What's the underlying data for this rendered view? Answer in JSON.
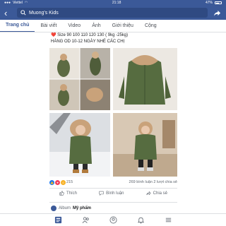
{
  "status_bar": {
    "carrier": "Viettel",
    "time": "21:18",
    "battery": "47%"
  },
  "header": {
    "search_text": "Muong's Kids"
  },
  "tabs": [
    "Trang chủ",
    "Bài viết",
    "Video",
    "Ảnh",
    "Giới thiệu",
    "Cộng"
  ],
  "post": {
    "heart": "❤️",
    "line1": "Size 90 100 110 120 130 ( 9kg -25kg)",
    "line2": "HÀNG OD 10-12 NGÀY NHÉ CÁC CHỊ"
  },
  "reactions": {
    "count": "215",
    "comments": "269 bình luận",
    "shares": "2 lượt chia sẻ"
  },
  "actions": {
    "like": "Thích",
    "comment": "Bình luận",
    "share": "Chia sẻ"
  },
  "album": {
    "prefix": "Album",
    "name": "Mỹ phẩm"
  },
  "colors": {
    "brand": "#3b5998",
    "jacket": "#556b3f",
    "fur": "#c9a27a"
  }
}
